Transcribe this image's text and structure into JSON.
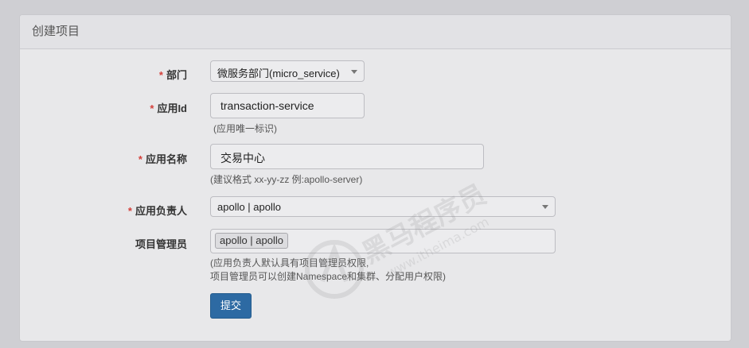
{
  "panel": {
    "title": "创建项目"
  },
  "form": {
    "required_mark": "*",
    "department": {
      "label": "部门",
      "value": "微服务部门(micro_service)"
    },
    "app_id": {
      "label": "应用Id",
      "value": "transaction-service",
      "help": "(应用唯一标识)"
    },
    "app_name": {
      "label": "应用名称",
      "value": "交易中心",
      "help": "(建议格式 xx-yy-zz 例:apollo-server)"
    },
    "owner": {
      "label": "应用负责人",
      "value": "apollo | apollo"
    },
    "admins": {
      "label": "项目管理员",
      "tags": [
        "apollo | apollo"
      ],
      "help_line1": "(应用负责人默认具有项目管理员权限,",
      "help_line2": "项目管理员可以创建Namespace和集群、分配用户权限)"
    },
    "submit_label": "提交"
  },
  "watermark": {
    "text": "黑马程序员",
    "url": "www.itheima.com"
  }
}
